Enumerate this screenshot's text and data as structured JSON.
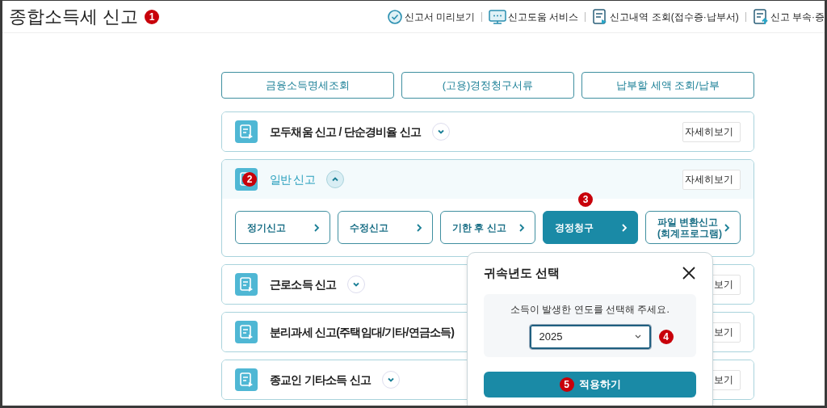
{
  "header": {
    "title": "종합소득세 신고",
    "step": "1",
    "links": [
      {
        "label": "신고서 미리보기"
      },
      {
        "label": "신고도움 서비스"
      },
      {
        "label": "신고내역 조회(접수증·납부서)"
      },
      {
        "label": "신고 부속·증"
      }
    ]
  },
  "quick_buttons": [
    "금융소득명세조회",
    "(고용)경정청구서류",
    "납부할 세액 조회/납부"
  ],
  "cards": [
    {
      "title": "모두채움 신고 / 단순경비율 신고",
      "expanded": false,
      "detail_button": "자세히보기"
    },
    {
      "title": "일반 신고",
      "expanded": true,
      "step": "2",
      "detail_button": "자세히보기",
      "options": [
        {
          "label": "정기신고",
          "selected": false
        },
        {
          "label": "수정신고",
          "selected": false
        },
        {
          "label": "기한 후 신고",
          "selected": false
        },
        {
          "label": "경정청구",
          "selected": true,
          "step": "3"
        },
        {
          "label": "파일 변환신고\n(회계프로그램)",
          "selected": false
        }
      ]
    },
    {
      "title": "근로소득 신고",
      "expanded": false,
      "detail_button": "보기"
    },
    {
      "title": "분리과세 신고(주택임대/기타/연금소득)",
      "detail_button": "보기"
    },
    {
      "title": "종교인 기타소득 신고",
      "expanded": false,
      "detail_button": "보기"
    }
  ],
  "dialog": {
    "title": "귀속년도 선택",
    "prompt": "소득이 발생한 연도를 선택해 주세요.",
    "year": "2025",
    "year_step": "4",
    "apply": "적용하기",
    "apply_step": "5"
  }
}
